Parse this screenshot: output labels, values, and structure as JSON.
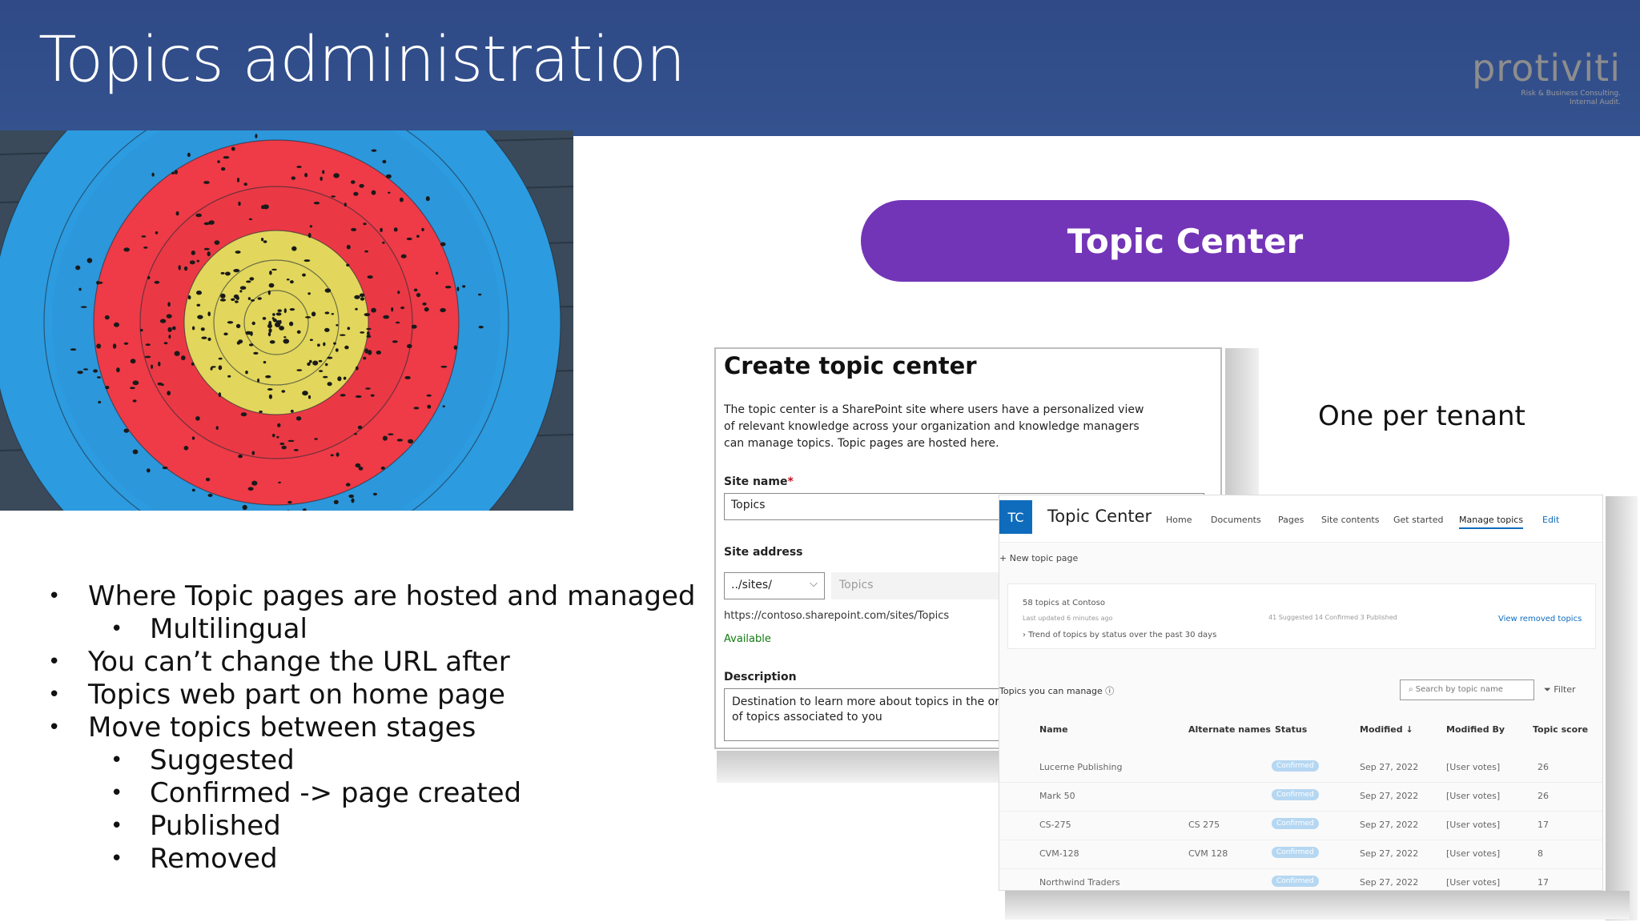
{
  "slide": {
    "title": "Topics administration",
    "logo_word": "protiviti",
    "logo_tag_1": "Risk & Business Consulting.",
    "logo_tag_2": "Internal Audit."
  },
  "pill_label": "Topic Center",
  "side_note": "One per tenant",
  "bullets": [
    {
      "text": "Where Topic pages are hosted and managed",
      "level": 1
    },
    {
      "text": "Multilingual",
      "level": 2
    },
    {
      "text": "You can’t change the URL after",
      "level": 1
    },
    {
      "text": "Topics web part on home page",
      "level": 1
    },
    {
      "text": "Move topics between stages",
      "level": 1
    },
    {
      "text": "Suggested",
      "level": 2
    },
    {
      "text": "Confirmed -> page created",
      "level": 2
    },
    {
      "text": "Published",
      "level": 2
    },
    {
      "text": "Removed",
      "level": 2
    }
  ],
  "create_panel": {
    "title": "Create topic center",
    "description": "The topic center is a SharePoint site where users have a personalized view of relevant knowledge across your organization and knowledge managers can manage topics. Topic pages are hosted here.",
    "site_name_label": "Site name",
    "required_mark": "*",
    "site_name_value": "Topics",
    "site_address_label": "Site address",
    "site_address_prefix": "../sites/",
    "site_address_value": "Topics",
    "url": "https://contoso.sharepoint.com/sites/Topics",
    "availability": "Available",
    "description_label": "Description",
    "description_value": "Destination to learn more about topics in the org\nof topics associated to you"
  },
  "topic_center": {
    "badge": "TC",
    "site_name": "Topic Center",
    "nav": [
      "Home",
      "Documents",
      "Pages",
      "Site contents",
      "Get started",
      "Manage topics",
      "Edit"
    ],
    "active_nav": "Manage topics",
    "new_page": "+  New topic page",
    "summary_title": "58 topics at Contoso",
    "summary_updated": "Last updated 6 minutes ago",
    "summary_trend": "›  Trend of topics by status over the past 30 days",
    "summary_counts": "41 Suggested     14 Confirmed     3 Published",
    "view_removed": "View removed topics",
    "section_title": "Topics you can manage  ⓘ",
    "search_placeholder": "Search by topic name",
    "filter_label": "Filter",
    "columns": [
      "Name",
      "Alternate names",
      "Status",
      "Modified ↓",
      "Modified By",
      "Topic score"
    ],
    "rows": [
      {
        "name": "Lucerne Publishing",
        "alt": "",
        "status": "Confirmed",
        "modified": "Sep 27, 2022",
        "by": "[User votes]",
        "score": "26"
      },
      {
        "name": "Mark 50",
        "alt": "",
        "status": "Confirmed",
        "modified": "Sep 27, 2022",
        "by": "[User votes]",
        "score": "26"
      },
      {
        "name": "CS-275",
        "alt": "CS 275",
        "status": "Confirmed",
        "modified": "Sep 27, 2022",
        "by": "[User votes]",
        "score": "17"
      },
      {
        "name": "CVM-128",
        "alt": "CVM 128",
        "status": "Confirmed",
        "modified": "Sep 27, 2022",
        "by": "[User votes]",
        "score": "8"
      },
      {
        "name": "Northwind Traders",
        "alt": "",
        "status": "Confirmed",
        "modified": "Sep 27, 2022",
        "by": "[User votes]",
        "score": "17"
      }
    ]
  },
  "colors": {
    "banner": "#2f4a86",
    "pill": "#7335b7",
    "target_blue": "#2d9be0",
    "target_red": "#ee3b47",
    "target_yellow": "#e2d75c",
    "accent_blue": "#0f6cbd"
  }
}
